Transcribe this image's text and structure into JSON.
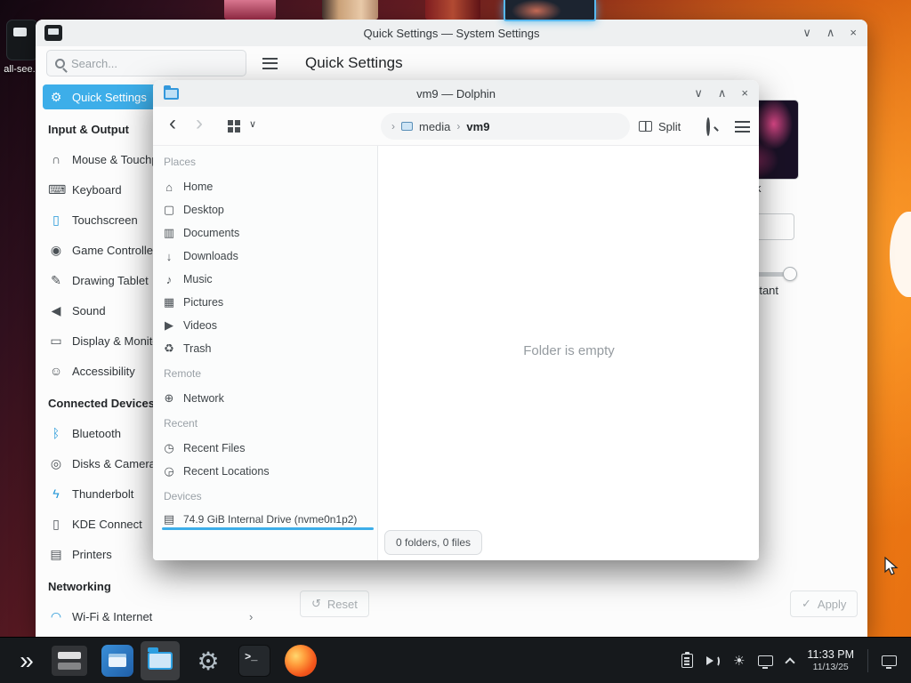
{
  "chrome": {
    "minimize_icon": "∨",
    "maximize_icon": "∧",
    "close_icon": "×",
    "chevron_right": "›",
    "chevron_down": "∨",
    "back_icon": "‹",
    "forward_icon": "›",
    "reset_icon": "↺",
    "apply_icon": "✓",
    "launcher_icon": "»",
    "konsole_prompt": ">_",
    "accent_color": "#3daee9"
  },
  "desktop": {
    "icon_label": "all-see..."
  },
  "settings": {
    "title": "Quick Settings — System Settings",
    "search_placeholder": "Search...",
    "page_title": "Quick Settings",
    "nav": [
      {
        "label": "Quick Settings",
        "icon": "quick-settings-icon",
        "glyph": "⚙",
        "selected": true
      },
      {
        "header": "Input & Output"
      },
      {
        "label": "Mouse & Touchpad",
        "icon": "mouse-icon",
        "glyph": "∩"
      },
      {
        "label": "Keyboard",
        "icon": "keyboard-icon",
        "glyph": "⌨"
      },
      {
        "label": "Touchscreen",
        "icon": "touchscreen-icon",
        "glyph": "▯"
      },
      {
        "label": "Game Controllers",
        "icon": "game-controller-icon",
        "glyph": "◉"
      },
      {
        "label": "Drawing Tablet",
        "icon": "drawing-tablet-icon",
        "glyph": "✎"
      },
      {
        "label": "Sound",
        "icon": "sound-icon",
        "glyph": "◀"
      },
      {
        "label": "Display & Monitor",
        "icon": "display-monitor-icon",
        "glyph": "▭"
      },
      {
        "label": "Accessibility",
        "icon": "accessibility-icon",
        "glyph": "☺"
      },
      {
        "header": "Connected Devices"
      },
      {
        "label": "Bluetooth",
        "icon": "bluetooth-icon",
        "glyph": "ᛒ",
        "color": "blue"
      },
      {
        "label": "Disks & Cameras",
        "icon": "disks-cameras-icon",
        "glyph": "◎"
      },
      {
        "label": "Thunderbolt",
        "icon": "thunderbolt-icon",
        "glyph": "ϟ",
        "color": "blue"
      },
      {
        "label": "KDE Connect",
        "icon": "kde-connect-icon",
        "glyph": "▯"
      },
      {
        "label": "Printers",
        "icon": "printer-icon",
        "glyph": "▤"
      },
      {
        "header": "Networking"
      },
      {
        "label": "Wi-Fi & Internet",
        "icon": "wifi-icon",
        "glyph": "◠",
        "color": "blue"
      }
    ],
    "content": {
      "theme_label": "Dark",
      "slider_label": "Instant"
    },
    "reset_label": "Reset",
    "apply_label": "Apply"
  },
  "dolphin": {
    "title": "vm9 — Dolphin",
    "split_label": "Split",
    "breadcrumb": {
      "root": "media",
      "current": "vm9"
    },
    "places": [
      {
        "header": "Places"
      },
      {
        "label": "Home",
        "icon": "home-icon",
        "glyph": "⌂"
      },
      {
        "label": "Desktop",
        "icon": "desktop-icon",
        "glyph": "▢"
      },
      {
        "label": "Documents",
        "icon": "documents-icon",
        "glyph": "▥"
      },
      {
        "label": "Downloads",
        "icon": "downloads-icon",
        "glyph": "↓"
      },
      {
        "label": "Music",
        "icon": "music-icon",
        "glyph": "♪"
      },
      {
        "label": "Pictures",
        "icon": "pictures-icon",
        "glyph": "▦"
      },
      {
        "label": "Videos",
        "icon": "videos-icon",
        "glyph": "▶"
      },
      {
        "label": "Trash",
        "icon": "trash-icon",
        "glyph": "♻"
      },
      {
        "header": "Remote"
      },
      {
        "label": "Network",
        "icon": "network-icon",
        "glyph": "⊕"
      },
      {
        "header": "Recent"
      },
      {
        "label": "Recent Files",
        "icon": "recent-files-icon",
        "glyph": "◷"
      },
      {
        "label": "Recent Locations",
        "icon": "recent-locations-icon",
        "glyph": "◶"
      },
      {
        "header": "Devices"
      },
      {
        "label": "74.9 GiB Internal Drive (nvme0n1p2)",
        "icon": "hard-drive-icon",
        "glyph": "▤"
      }
    ],
    "empty_message": "Folder is empty",
    "status": "0 folders, 0 files"
  },
  "taskbar": {
    "clock_time": "11:33 PM",
    "clock_date": "11/13/25",
    "tray_icons": [
      "clipboard-icon",
      "volume-icon",
      "brightness-icon",
      "display-icon",
      "expand-tray-icon"
    ],
    "apps": [
      "app-launcher",
      "pager",
      "blue-app",
      "dolphin",
      "system-settings",
      "konsole",
      "firefox"
    ]
  }
}
